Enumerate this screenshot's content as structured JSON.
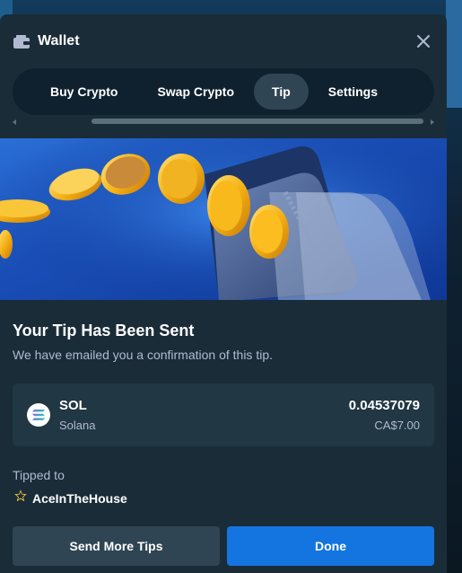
{
  "header": {
    "title": "Wallet",
    "icon": "wallet-icon",
    "close_icon": "close-icon"
  },
  "tabs": [
    {
      "label": "Buy Crypto",
      "active": false
    },
    {
      "label": "Swap Crypto",
      "active": false
    },
    {
      "label": "Tip",
      "active": true
    },
    {
      "label": "Settings",
      "active": false
    }
  ],
  "banner": {
    "image": "gold-coins-into-wallet-illustration"
  },
  "confirmation": {
    "heading": "Your Tip Has Been Sent",
    "subtext": "We have emailed you a confirmation of this tip."
  },
  "currency_card": {
    "icon": "solana-logo",
    "symbol": "SOL",
    "name": "Solana",
    "amount": "0.04537079",
    "fiat_value": "CA$7.00"
  },
  "tipped_to": {
    "label": "Tipped to",
    "badge_icon": "star-rank-icon",
    "username": "AceInTheHouse"
  },
  "buttons": {
    "send_more": "Send More Tips",
    "done": "Done"
  },
  "colors": {
    "modal_bg": "#1a2c38",
    "card_bg": "#213743",
    "primary": "#1475e1",
    "secondary": "#2f4553",
    "muted_text": "#b1bad3"
  }
}
